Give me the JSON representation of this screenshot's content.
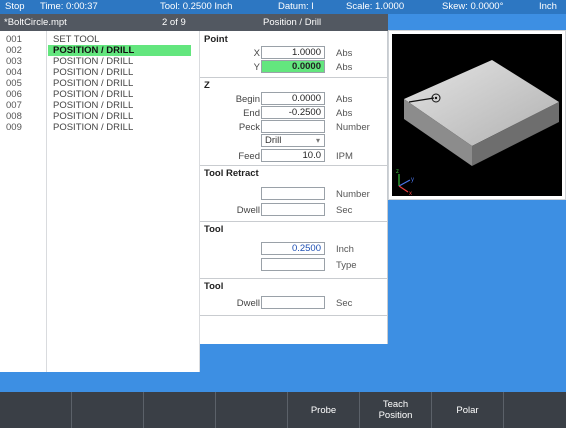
{
  "status_bar": {
    "mode": "Stop",
    "time": "Time: 0:00:37",
    "tool": "Tool: 0.2500 Inch",
    "datum": "Datum: I",
    "scale": "Scale: 1.0000",
    "skew": "Skew: 0.0000°",
    "units": "Inch"
  },
  "title_bar": {
    "filename": "*BoltCircle.mpt",
    "position": "2 of 9",
    "step_type": "Position / Drill"
  },
  "program_steps": [
    {
      "num": "001",
      "label": "SET TOOL"
    },
    {
      "num": "002",
      "label": "POSITION / DRILL",
      "active": true
    },
    {
      "num": "003",
      "label": "POSITION / DRILL"
    },
    {
      "num": "004",
      "label": "POSITION / DRILL"
    },
    {
      "num": "005",
      "label": "POSITION / DRILL"
    },
    {
      "num": "006",
      "label": "POSITION / DRILL"
    },
    {
      "num": "007",
      "label": "POSITION / DRILL"
    },
    {
      "num": "008",
      "label": "POSITION / DRILL"
    },
    {
      "num": "009",
      "label": "POSITION / DRILL"
    }
  ],
  "form": {
    "point": {
      "title": "Point",
      "x_label": "X",
      "x_value": "1.0000",
      "x_unit": "Abs",
      "y_label": "Y",
      "y_value": "0.0000",
      "y_unit": "Abs"
    },
    "z": {
      "title": "Z",
      "begin_label": "Begin",
      "begin_value": "0.0000",
      "begin_unit": "Abs",
      "end_label": "End",
      "end_value": "-0.2500",
      "end_unit": "Abs",
      "peck_label": "Peck",
      "peck_value": "",
      "peck_unit": "Number",
      "cycle_value": "Drill",
      "feed_label": "Feed",
      "feed_value": "10.0",
      "feed_unit": "IPM"
    },
    "tool_retract": {
      "title": "Tool Retract",
      "number_value": "",
      "number_unit": "Number",
      "dwell_label": "Dwell",
      "dwell_value": "",
      "dwell_unit": "Sec"
    },
    "tool": {
      "title": "Tool",
      "diameter_value": "0.2500",
      "diameter_unit": "Inch",
      "type_value": "",
      "type_unit": "Type"
    },
    "tool2": {
      "title": "Tool",
      "dwell_label": "Dwell",
      "dwell_value": "",
      "dwell_unit": "Sec"
    }
  },
  "preview": {
    "axis_z": "z",
    "axis_y": "y",
    "axis_x": "x"
  },
  "softkeys": [
    "",
    "",
    "",
    "",
    "Probe",
    "Teach Position",
    "Polar",
    ""
  ],
  "colors": {
    "background": "#3d8fe3",
    "status_bar": "#2d77c2",
    "title_bar": "#525861",
    "active_highlight": "#63e67e",
    "softkey_bar": "#3a3f46"
  }
}
